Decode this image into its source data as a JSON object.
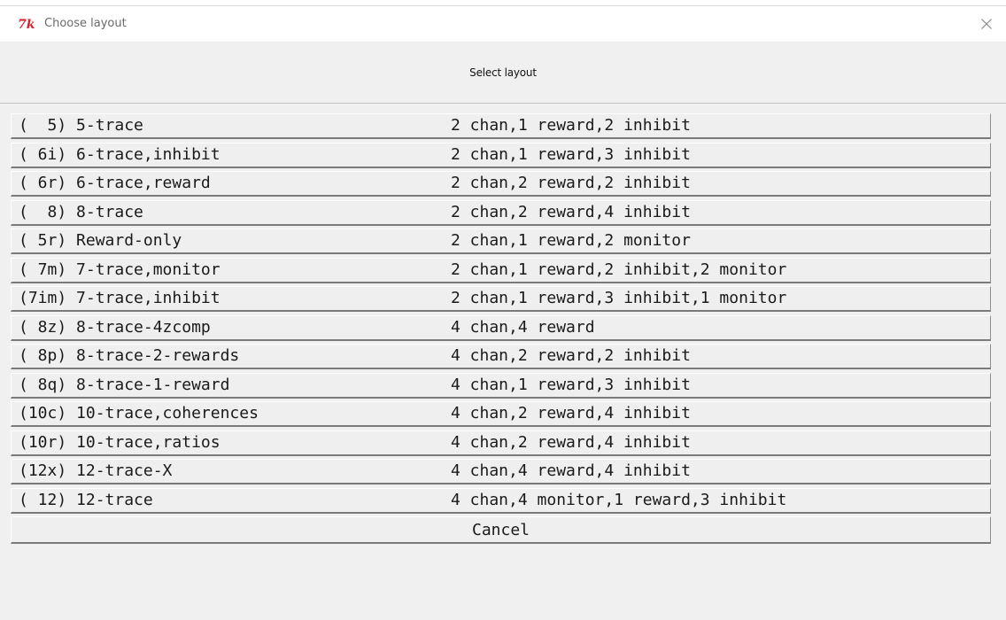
{
  "window": {
    "title": "Choose layout",
    "app_icon": "tk-feather-icon",
    "close_icon": "close-icon"
  },
  "header": {
    "label": "Select layout"
  },
  "layouts": [
    {
      "code": "(  5) 5-trace",
      "desc": "2 chan,1 reward,2 inhibit"
    },
    {
      "code": "( 6i) 6-trace,inhibit",
      "desc": "2 chan,1 reward,3 inhibit"
    },
    {
      "code": "( 6r) 6-trace,reward",
      "desc": "2 chan,2 reward,2 inhibit"
    },
    {
      "code": "(  8) 8-trace",
      "desc": "2 chan,2 reward,4 inhibit"
    },
    {
      "code": "( 5r) Reward-only",
      "desc": "2 chan,1 reward,2 monitor"
    },
    {
      "code": "( 7m) 7-trace,monitor",
      "desc": "2 chan,1 reward,2 inhibit,2 monitor"
    },
    {
      "code": "(7im) 7-trace,inhibit",
      "desc": "2 chan,1 reward,3 inhibit,1 monitor"
    },
    {
      "code": "( 8z) 8-trace-4zcomp",
      "desc": "4 chan,4 reward"
    },
    {
      "code": "( 8p) 8-trace-2-rewards",
      "desc": "4 chan,2 reward,2 inhibit"
    },
    {
      "code": "( 8q) 8-trace-1-reward",
      "desc": "4 chan,1 reward,3 inhibit"
    },
    {
      "code": "(10c) 10-trace,coherences",
      "desc": "4 chan,2 reward,4 inhibit"
    },
    {
      "code": "(10r) 10-trace,ratios",
      "desc": "4 chan,2 reward,4 inhibit"
    },
    {
      "code": "(12x) 12-trace-X",
      "desc": "4 chan,4 reward,4 inhibit"
    },
    {
      "code": "( 12) 12-trace",
      "desc": "4 chan,4 monitor,1 reward,3 inhibit"
    }
  ],
  "cancel_label": "Cancel",
  "colors": {
    "icon_red": "#d2232a",
    "background": "#f0f0f0"
  }
}
